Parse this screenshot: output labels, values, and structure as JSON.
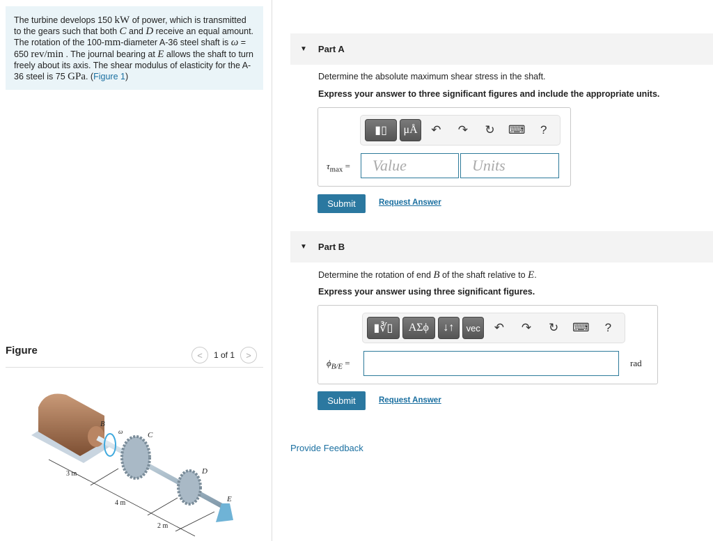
{
  "problem": {
    "t1": "The turbine develops 150 ",
    "power": "kW",
    "t2": " of power, which is transmitted to the gears such that both ",
    "C": "C",
    "t3": " and ",
    "D": "D",
    "t4": " receive an equal amount. The rotation of the 100-",
    "mm": "mm",
    "t5": "-diameter A-36 steel shaft is ",
    "omega": "ω",
    "t6": " = 650 ",
    "rpm": "rev/min",
    "t7": " . The journal bearing at ",
    "E": "E",
    "t8": " allows the shaft to turn freely about its axis. The shear modulus of elasticity for the A-36 steel is 75 ",
    "gpa": "GPa",
    "t9": ". (",
    "figlink": "Figure 1",
    "t10": ")"
  },
  "figure": {
    "title": "Figure",
    "pager": "1 of 1",
    "prev": "<",
    "next": ">",
    "labels": {
      "B": "B",
      "C": "C",
      "D": "D",
      "E": "E",
      "omega": "ω",
      "d1": "3 m",
      "d2": "4 m",
      "d3": "2 m"
    }
  },
  "partA": {
    "title": "Part A",
    "question": "Determine the absolute maximum shear stress in the shaft.",
    "instruction": "Express your answer to three significant figures and include the appropriate units.",
    "label": "τ",
    "label_sub": "max",
    "eq": " =",
    "value_placeholder": "Value",
    "units_placeholder": "Units",
    "mu": "μÅ",
    "help": "?",
    "submit": "Submit",
    "request": "Request Answer"
  },
  "partB": {
    "title": "Part B",
    "q1": "Determine the rotation of end ",
    "B": "B",
    "q2": " of the shaft relative to ",
    "E": "E",
    "q3": ".",
    "instruction": "Express your answer using three significant figures.",
    "label": "ϕ",
    "label_sub": "B/E",
    "eq": " =",
    "unit": "rad",
    "greek": "ΑΣϕ",
    "arrows": "↓↑",
    "vec": "vec",
    "help": "?",
    "submit": "Submit",
    "request": "Request Answer"
  },
  "feedback": "Provide Feedback",
  "colors": {
    "accent": "#2b78a0",
    "problem_bg": "#eaf4f8"
  }
}
